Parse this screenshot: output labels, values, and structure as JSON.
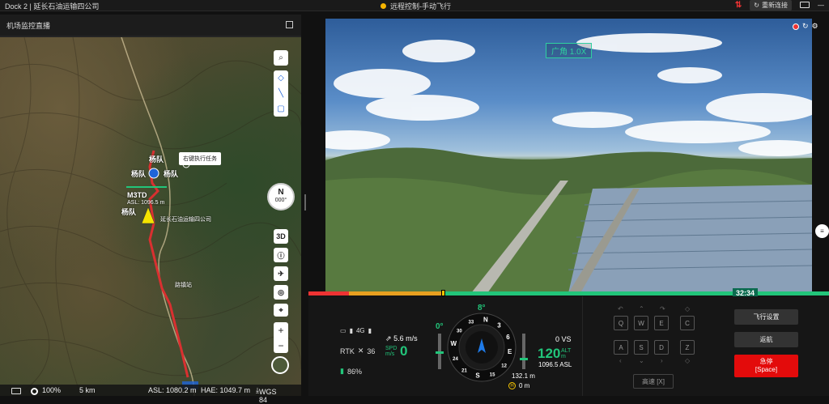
{
  "titlebar": {
    "left_title": "Dock 2 | 延长石油运输四公司",
    "center_title": "远程控制-手动飞行",
    "reconnect": "重新连接"
  },
  "map": {
    "header": "机场监控直播",
    "labels": {
      "team1": "杨队",
      "team2": "杨队",
      "team3": "杨队",
      "team4": "杨队",
      "drone_model": "M3TD",
      "drone_asl": "ASL: 1096.5 m",
      "company": "延长石油运输四公司",
      "station": "路镇站"
    },
    "tooltip": "右键执行任务",
    "compass": {
      "letter": "N",
      "deg": "000°"
    },
    "btn_3d": "3D",
    "footer": {
      "zoom": "100%",
      "scale": "5 km",
      "asl": "ASL: 1080.2 m",
      "hae": "HAE: 1049.7 m",
      "datum": "WGS 84"
    }
  },
  "camera": {
    "zoom_tag": "广角 1.0X",
    "timer": "32:34"
  },
  "telemetry": {
    "signal": "4G",
    "rtk_label": "RTK",
    "rtk_sats": "36",
    "battery": "86%",
    "hspeed": "5.6 m/s",
    "spd_label_1": "SPD",
    "spd_label_2": "m/s",
    "spd_value": "0",
    "pitch": "0°",
    "heading": "8°",
    "vs": "0 VS",
    "alt_value": "120",
    "alt_label_1": "ALT",
    "alt_label_2": "m",
    "alt_asl": "1096.5 ASL",
    "dist": "132.1 m",
    "home_dist": "0 m",
    "compass_labels": [
      "N",
      "3",
      "6",
      "E",
      "12",
      "15",
      "S",
      "21",
      "24",
      "W",
      "30",
      "33"
    ]
  },
  "keys": {
    "Q": "Q",
    "W": "W",
    "E": "E",
    "C": "C",
    "A": "A",
    "S": "S",
    "D": "D",
    "Z": "Z",
    "speed": "高速 [X]"
  },
  "actions": {
    "flight_settings": "飞行设置",
    "return_home": "返航",
    "emergency_1": "急停",
    "emergency_2": "[Space]"
  },
  "colors": {
    "accent_green": "#22c57a",
    "danger_red": "#e30b0b",
    "warning_yellow": "#f5b400"
  }
}
